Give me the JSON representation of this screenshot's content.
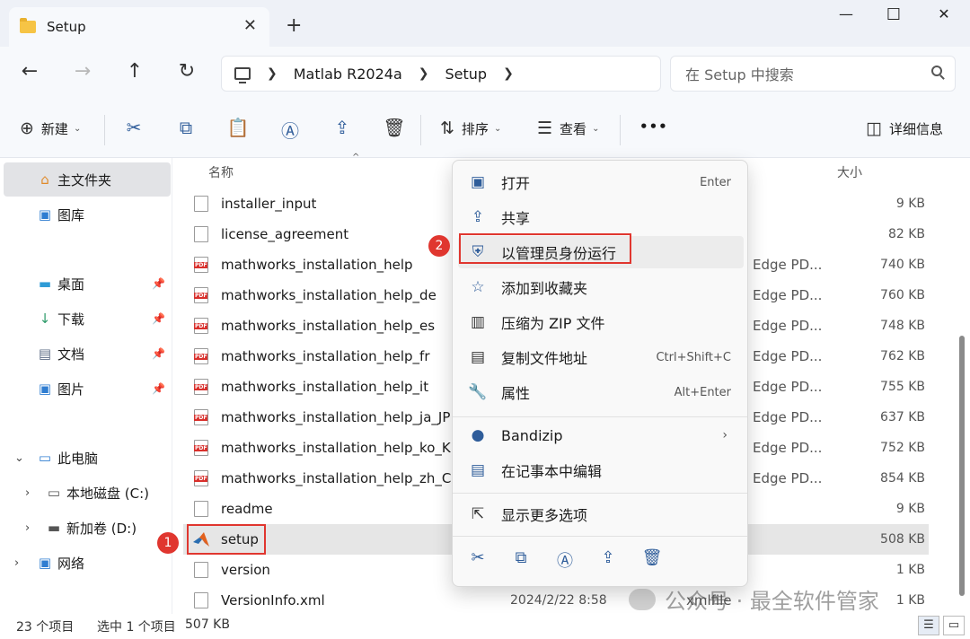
{
  "window": {
    "tab_title": "Setup",
    "tab_close": "✕",
    "new_tab": "+",
    "minimize": "—",
    "maximize": "☐",
    "close": "✕"
  },
  "addressbar": {
    "crumbs": [
      "Matlab R2024a",
      "Setup"
    ],
    "search_placeholder": "在 Setup 中搜索"
  },
  "toolbar": {
    "new_label": "新建",
    "sort_label": "排序",
    "view_label": "查看",
    "more_label": "•••",
    "details_label": "详细信息"
  },
  "nav": {
    "home": "主文件夹",
    "gallery": "图库",
    "desktop": "桌面",
    "downloads": "下载",
    "documents": "文档",
    "pictures": "图片",
    "this_pc": "此电脑",
    "local_disk": "本地磁盘 (C:)",
    "new_volume": "新加卷 (D:)",
    "network": "网络"
  },
  "columns": {
    "name": "名称",
    "size": "大小"
  },
  "files": [
    {
      "name": "installer_input",
      "icon": "doc",
      "type": "",
      "size": "9 KB"
    },
    {
      "name": "license_agreement",
      "icon": "doc",
      "type": "",
      "size": "82 KB"
    },
    {
      "name": "mathworks_installation_help",
      "icon": "pdf",
      "type": "Edge PD...",
      "size": "740 KB"
    },
    {
      "name": "mathworks_installation_help_de",
      "icon": "pdf",
      "type": "Edge PD...",
      "size": "760 KB"
    },
    {
      "name": "mathworks_installation_help_es",
      "icon": "pdf",
      "type": "Edge PD...",
      "size": "748 KB"
    },
    {
      "name": "mathworks_installation_help_fr",
      "icon": "pdf",
      "type": "Edge PD...",
      "size": "762 KB"
    },
    {
      "name": "mathworks_installation_help_it",
      "icon": "pdf",
      "type": "Edge PD...",
      "size": "755 KB"
    },
    {
      "name": "mathworks_installation_help_ja_JP",
      "icon": "pdf",
      "type": "Edge PD...",
      "size": "637 KB"
    },
    {
      "name": "mathworks_installation_help_ko_KR",
      "icon": "pdf",
      "type": "Edge PD...",
      "size": "752 KB"
    },
    {
      "name": "mathworks_installation_help_zh_CN",
      "icon": "pdf",
      "type": "Edge PD...",
      "size": "854 KB"
    },
    {
      "name": "readme",
      "icon": "doc",
      "type": "",
      "size": "9 KB"
    },
    {
      "name": "setup",
      "icon": "matlab",
      "type": "",
      "size": "508 KB"
    },
    {
      "name": "version",
      "icon": "doc",
      "type": "",
      "size": "1 KB"
    },
    {
      "name": "VersionInfo.xml",
      "icon": "doc",
      "type": "xmlfile",
      "date": "2024/2/22 8:58",
      "size": "1 KB"
    }
  ],
  "context_menu": {
    "open": "打开",
    "open_sc": "Enter",
    "share": "共享",
    "run_as_admin": "以管理员身份运行",
    "add_favorite": "添加到收藏夹",
    "compress_zip": "压缩为 ZIP 文件",
    "copy_path": "复制文件地址",
    "copy_path_sc": "Ctrl+Shift+C",
    "properties": "属性",
    "properties_sc": "Alt+Enter",
    "bandizip": "Bandizip",
    "edit_notepad": "在记事本中编辑",
    "more_options": "显示更多选项"
  },
  "annotations": {
    "badge1": "1",
    "badge2": "2"
  },
  "status": {
    "item_count": "23 个项目",
    "selected": "选中 1 个项目",
    "selected_size": "507 KB"
  },
  "watermark": "公众号 · 最全软件管家"
}
